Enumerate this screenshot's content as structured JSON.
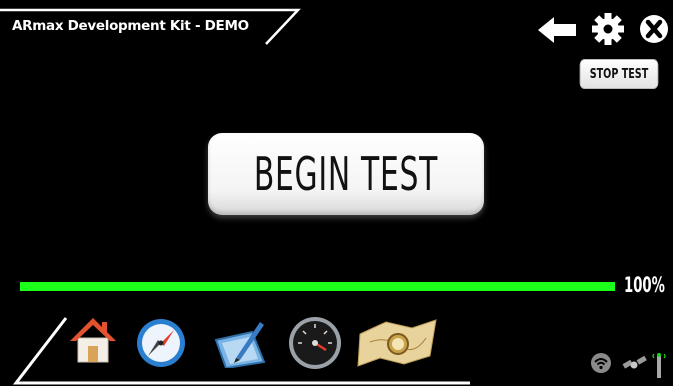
{
  "app": {
    "title": "ARmax Development Kit - DEMO"
  },
  "header": {
    "icons": [
      "back-arrow-icon",
      "gear-icon",
      "close-icon"
    ],
    "stop_label": "STOP TEST"
  },
  "main": {
    "begin_label": "BEGIN TEST",
    "progress": {
      "value": 1.0,
      "label": "100%"
    }
  },
  "dock": {
    "items": [
      "home-icon",
      "compass-icon",
      "drawing-tablet-icon",
      "speedometer-icon",
      "map-icon"
    ]
  },
  "status": {
    "icons": [
      "wifi-icon",
      "satellite-icon",
      "antenna-icon"
    ]
  },
  "colors": {
    "background": "#000000",
    "progress": "#1bff1b",
    "button": "#ffffff"
  }
}
